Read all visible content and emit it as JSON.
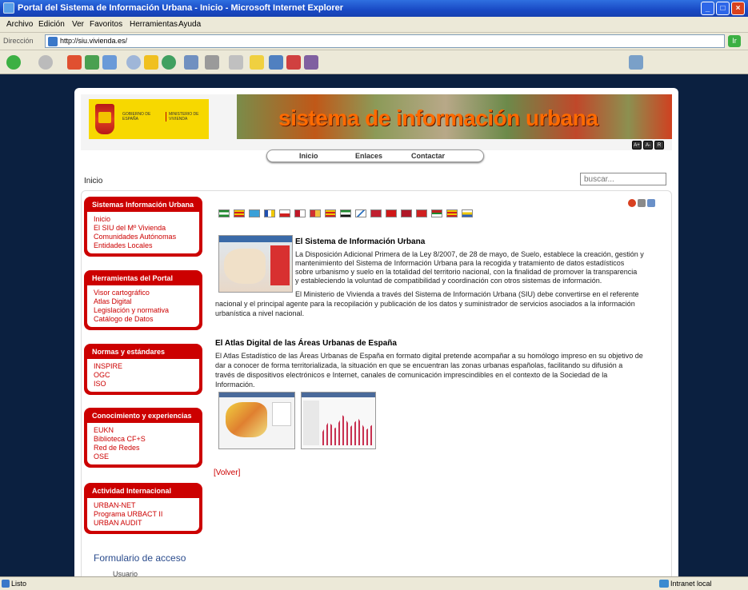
{
  "browser": {
    "title": "Portal del Sistema de Información Urbana - Inicio - Microsoft Internet Explorer",
    "menu": [
      "Archivo",
      "Edición",
      "Ver",
      "Favoritos",
      "Herramientas",
      "Ayuda"
    ],
    "address_label": "Dirección",
    "address": "http://siu.vivienda.es/",
    "go_label": "Ir",
    "status": "Listo",
    "zone": "Intranet local"
  },
  "header": {
    "logo_gobierno": "GOBIERNO DE ESPAÑA",
    "logo_ministerio": "MINISTERIO DE VIVIENDA",
    "banner_title": "sistema de información urbana",
    "font_buttons": [
      "A+",
      "A-",
      "R"
    ]
  },
  "nav": {
    "tabs": [
      "Inicio",
      "Enlaces",
      "Contactar"
    ]
  },
  "breadcrumb": "Inicio",
  "search": {
    "placeholder": "buscar..."
  },
  "sidebar": {
    "sections": [
      {
        "title": "Sistemas Información Urbana",
        "items": [
          "Inicio",
          "El SIU del Mº Vivienda",
          "Comunidades Autónomas",
          "Entidades Locales"
        ]
      },
      {
        "title": "Herramientas del Portal",
        "items": [
          "Visor cartográfico",
          "Atlas Digital",
          "Legislación y normativa",
          "Catálogo de Datos"
        ]
      },
      {
        "title": "Normas y estándares",
        "items": [
          "INSPIRE",
          "OGC",
          "ISO"
        ]
      },
      {
        "title": "Conocimiento y experiencias",
        "items": [
          "EUKN",
          "Biblioteca CF+S",
          "Red de Redes",
          "OSE"
        ]
      },
      {
        "title": "Actividad Internacional",
        "items": [
          "URBAN-NET",
          "Programa URBACT II",
          "URBAN AUDIT"
        ]
      }
    ],
    "form_title": "Formulario de acceso",
    "user_label": "Usuario"
  },
  "main": {
    "section1_title": "El Sistema de Información Urbana",
    "section1_lines": [
      "La Disposición Adicional Primera de la Ley 8/2007, de 28 de mayo, de Suelo, establece la creación, gestión y",
      "mantenimiento del Sistema de Información Urbana para la recogida y tratamiento de datos estadísticos",
      "sobre urbanismo y suelo en la totalidad del territorio nacional, con la finalidad de promover la transparencia",
      "y estableciendo la voluntad de compatibilidad y coordinación con otros sistemas de información."
    ],
    "section1_lines_b": [
      "El Ministerio de Vivienda a través del Sistema de Información Urbana (SIU) debe convertirse en el referente",
      "nacional y el principal agente para la recopilación y publicación de los datos  y suministrador de servicios asociados a la información",
      "urbanística a nivel nacional."
    ],
    "section2_title": "El Atlas Digital de las Áreas Urbanas de España",
    "section2_lines": [
      "El Atlas Estadístico de las Áreas Urbanas de España en formato digital pretende acompañar a su homólogo impreso en su objetivo de",
      "dar a conocer de forma territorializada, la situación en que se encuentran las zonas urbanas españolas, facilitando su difusión a",
      "través de dispositivos electrónicos e Internet, canales de comunicación imprescindibles en el contexto de la Sociedad de la",
      "Información."
    ],
    "volver": "[Volver]"
  },
  "colors": {
    "sidebar_red": "#cc0000",
    "page_bg": "#0b2040",
    "banner_text": "#ff6a00"
  }
}
